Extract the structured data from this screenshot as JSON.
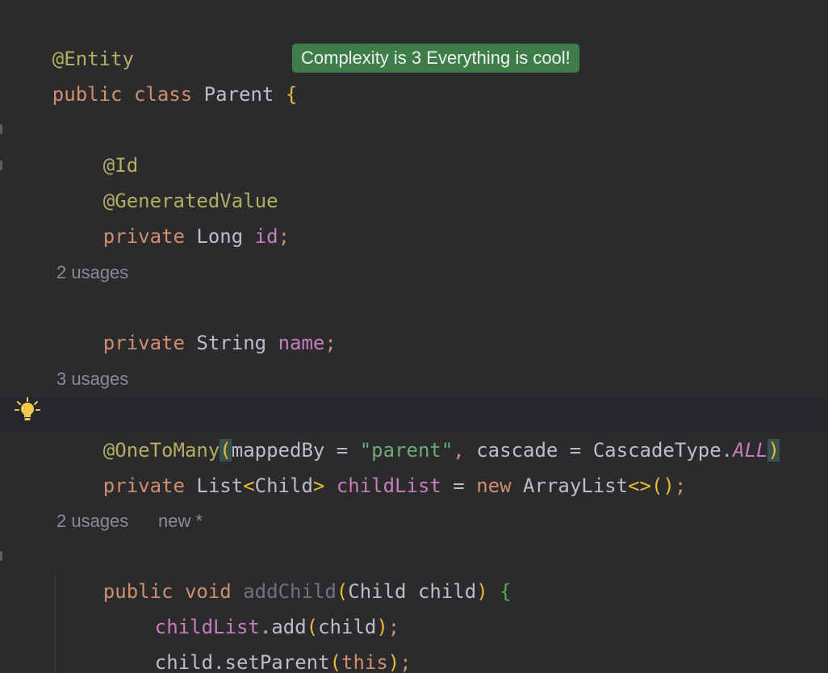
{
  "editor": {
    "line_1": {
      "annotation": "@Entity"
    },
    "line_2": {
      "kw_public": "public",
      "kw_class": "class",
      "class_name": "Parent",
      "brace": "{"
    },
    "complexity_hint": "Complexity is 3 Everything is cool!",
    "line_id_ann": "@Id",
    "line_genval_ann": "@GeneratedValue",
    "line_id_decl": {
      "kw_private": "private",
      "type": "Long",
      "field": "id",
      "semi": ";"
    },
    "name_usages": "2 usages",
    "line_name_decl": {
      "kw_private": "private",
      "type": "String",
      "field": "name",
      "semi": ";"
    },
    "childlist_usages": "3 usages",
    "line_onetomany": {
      "annotation": "@OneToMany",
      "open_paren": "(",
      "param1": "mappedBy",
      "eq1": " = ",
      "value1": "\"parent\"",
      "comma": ",",
      "param2": "cascade",
      "eq2": " = ",
      "enum_type": "CascadeType",
      "dot": ".",
      "enum_value": "ALL",
      "close_paren": ")"
    },
    "line_childlist_decl": {
      "kw_private": "private",
      "type": "List",
      "lt": "<",
      "type_arg": "Child",
      "gt": ">",
      "field": "childList",
      "eq": " = ",
      "kw_new": "new",
      "ctor": "ArrayList",
      "diamond": "<>",
      "parens": "()",
      "semi": ";"
    },
    "addchild_usages": "2 usages",
    "addchild_new": "new *",
    "line_addchild_sig": {
      "kw_public": "public",
      "kw_void": "void",
      "method": "addChild",
      "open_paren": "(",
      "param_type": "Child",
      "param_name": "child",
      "close_paren": ")",
      "brace": "{"
    },
    "line_body_1": {
      "field": "childList",
      "call": ".add",
      "open_paren": "(",
      "arg": "child",
      "close_paren": ")",
      "semi": ";"
    },
    "line_body_2": {
      "target": "child",
      "call": ".setParent",
      "open_paren": "(",
      "kw_this": "this",
      "close_paren": ")",
      "semi": ";"
    }
  },
  "icons": {
    "intention": "lightbulb-icon"
  },
  "colors": {
    "background": "#2b2b2d",
    "keyword": "#cf8e6d",
    "annotation": "#b3ae60",
    "field": "#c77dbb",
    "string": "#6aab73",
    "badge": "#3e7c4a"
  }
}
